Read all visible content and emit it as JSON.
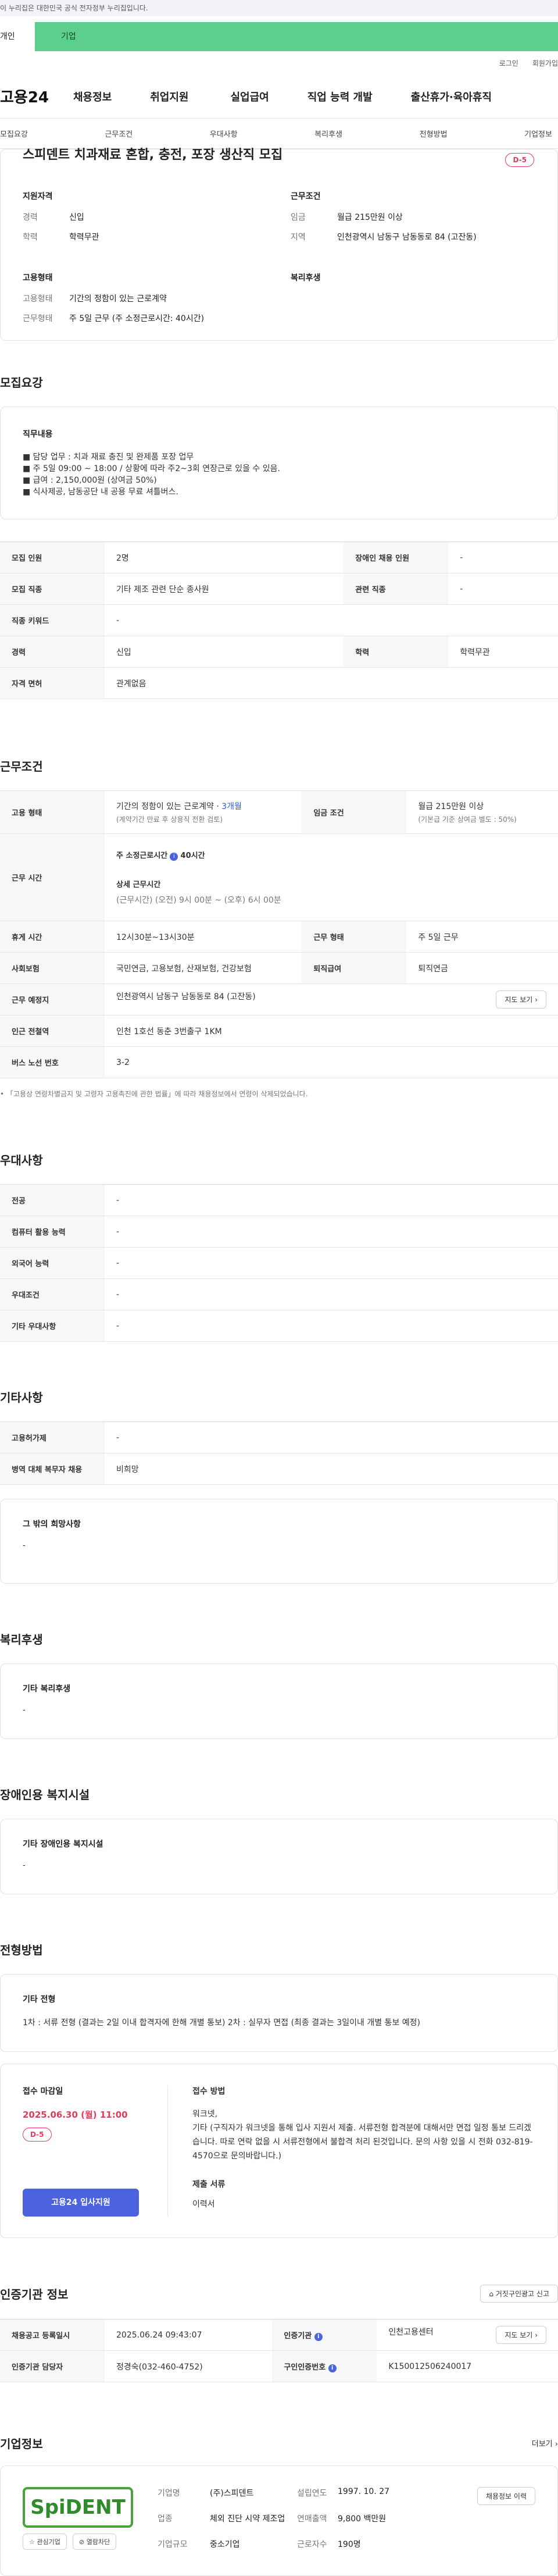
{
  "gov_banner": "이 누리집은 대한민국 공식 전자정부 누리집입니다.",
  "type_tabs": {
    "personal": "개인",
    "company": "기업"
  },
  "header_util": {
    "login": "로그인",
    "join": "회원가입"
  },
  "logo": "고용24",
  "gnb": [
    "채용정보",
    "취업지원",
    "실업급여",
    "직업 능력 개발",
    "출산휴가·육아휴직"
  ],
  "sub_nav": [
    "모집요강",
    "근무조건",
    "우대사항",
    "복리후생",
    "전형방법",
    "기업정보"
  ],
  "summary": {
    "title": "스피덴트 치과재료 혼합, 충전, 포장 생산직 모집",
    "dday": "D-5",
    "qual_head": "지원자격",
    "qual": [
      {
        "k": "경력",
        "v": "신입"
      },
      {
        "k": "학력",
        "v": "학력무관"
      }
    ],
    "cond_head": "근무조건",
    "cond": [
      {
        "k": "임금",
        "v": "월급 215만원 이상"
      },
      {
        "k": "지역",
        "v": "인천광역시 남동구 남동동로 84 (고잔동)"
      }
    ],
    "emp_head": "고용형태",
    "emp": [
      {
        "k": "고용형태",
        "v": "기간의 정함이 있는 근로계약"
      },
      {
        "k": "근무형태",
        "v": "주 5일 근무 (주 소정근로시간: 40시간)"
      }
    ],
    "welfare_head": "복리후생"
  },
  "recruit": {
    "section": "모집요강",
    "duty_title": "직무내용",
    "duties": [
      "■ 담당 업무 : 치과 재료 충진 및 완제품 포장 업무",
      "■ 주 5일  09:00 ~ 18:00  /  상황에 따라 주2~3회 연장근로 있을 수 있음.",
      "■ 급여 : 2,150,000원 (상여금 50%)",
      "■ 식사제공, 남동공단 내 공용 무료 셔틀버스."
    ],
    "row1": {
      "k1": "모집 인원",
      "v1": "2명",
      "k2": "장애인 채용 인원",
      "v2": "-"
    },
    "row2": {
      "k1": "모집 직종",
      "v1": "기타 제조 관련 단순 종사원",
      "k2": "관련 직종",
      "v2": "-"
    },
    "row3": {
      "k1": "직종 키워드",
      "v1": "-"
    },
    "row4": {
      "k1": "경력",
      "v1": "신입",
      "k2": "학력",
      "v2": "학력무관"
    },
    "row5": {
      "k1": "자격 면허",
      "v1": "관계없음"
    }
  },
  "work": {
    "section": "근무조건",
    "type_k": "고용 형태",
    "type_v1": "기간의 정함이 있는 근로계약 · ",
    "type_v1_hl": "3개월",
    "type_v2": "(계약기간 만료 후 상용직 전환 검토)",
    "wage_k": "임금 조건",
    "wage_v1": "월급 215만원 이상",
    "wage_v2": "(기본급 기준 상여금 별도 : 50%)",
    "hours_k": "근무 시간",
    "hours_std": "주 소정근로시간",
    "hours_std_v": "40시간",
    "hours_detail": "상세 근무시간",
    "hours_detail_v": "(근무시간) (오전) 9시 00분 ~ (오후) 6시 00분",
    "rest_k": "휴게 시간",
    "rest_v": "12시30분~13시30분",
    "form_k": "근무 형태",
    "form_v": "주 5일 근무",
    "ins_k": "사회보험",
    "ins_v": "국민연금, 고용보험, 산재보험, 건강보험",
    "retire_k": "퇴직급여",
    "retire_v": "퇴직연금",
    "place_k": "근무 예정지",
    "place_v": "인천광역시 남동구 남동동로 84 (고잔동)",
    "map_btn": "지도 보기",
    "subway_k": "인근 전철역",
    "subway_v": "인천 1호선 동춘 3번출구 1KM",
    "bus_k": "버스 노선 번호",
    "bus_v": "3-2",
    "footnote": "「고용상 연령차별금지 및 고령자 고용촉진에 관한 법률」에 따라 채용정보에서 연령이 삭제되었습니다."
  },
  "prefer": {
    "section": "우대사항",
    "rows": [
      {
        "k": "전공",
        "v": "-"
      },
      {
        "k": "컴퓨터 활용 능력",
        "v": "-"
      },
      {
        "k": "외국어 능력",
        "v": "-"
      },
      {
        "k": "우대조건",
        "v": "-"
      },
      {
        "k": "기타 우대사항",
        "v": "-"
      }
    ]
  },
  "etc": {
    "section": "기타사항",
    "rows": [
      {
        "k": "고용허가제",
        "v": "-"
      },
      {
        "k": "병역 대체 복무자 채용",
        "v": "비희망"
      }
    ],
    "other_title": "그 밖의 희망사항",
    "other_v": "-"
  },
  "welfare": {
    "section": "복리후생",
    "title": "기타 복리후생",
    "v": "-"
  },
  "disabled": {
    "section": "장애인용 복지시설",
    "title": "기타 장애인용 복지시설",
    "v": "-"
  },
  "selection": {
    "section": "전형방법",
    "title": "기타 전형",
    "v": "1차 : 서류 전형 (결과는 2일 이내 합격자에 한해 개별 통보) 2차 : 실무자 면접 (최종 결과는 3일이내 개별 통보 예정)"
  },
  "apply": {
    "deadline_title": "접수 마감일",
    "deadline": "2025.06.30 (월) 11:00",
    "dday": "D-5",
    "apply_btn": "고용24 입사지원",
    "method_title": "접수 방법",
    "method_v1": "워크넷,",
    "method_v2": "기타 (구직자가 워크넷을 통해 입사 지원서 제출. 서류전형 합격분에 대해서만 면접 일정 통보 드리겠습니다. 따로 연락 없을 시 서류전형에서 불합격 처리 된것입니다. 문의 사항 있을 시 전화 032-819-4570으로 문의바랍니다.)",
    "docs_title": "제출 서류",
    "docs_v": "이력서"
  },
  "cert": {
    "section": "인증기관 정보",
    "report_btn": "거짓구인광고 신고",
    "reg_k": "채용공고 등록일시",
    "reg_v": "2025.06.24 09:43:07",
    "org_k": "인증기관",
    "org_v": "인천고용센터",
    "map_btn": "지도 보기",
    "mgr_k": "인증기관 담당자",
    "mgr_v": "정경숙(032-460-4752)",
    "num_k": "구인인증번호",
    "num_v": "K150012506240017"
  },
  "company": {
    "section": "기업정보",
    "more": "더보기",
    "logo_text": "SpiDENT",
    "chip1": "관심기업",
    "chip2": "열람차단",
    "name_k": "기업명",
    "name_v": "(주)스피덴트",
    "est_k": "설립연도",
    "est_v": "1997. 10. 27",
    "biz_k": "업종",
    "biz_v": "체외 진단 시약 제조업",
    "sales_k": "연매출액",
    "sales_v": "9,800 백만원",
    "size_k": "기업규모",
    "size_v": "중소기업",
    "emp_k": "근로자수",
    "emp_v": "190명",
    "recruit_btn": "채용정보 이력"
  }
}
